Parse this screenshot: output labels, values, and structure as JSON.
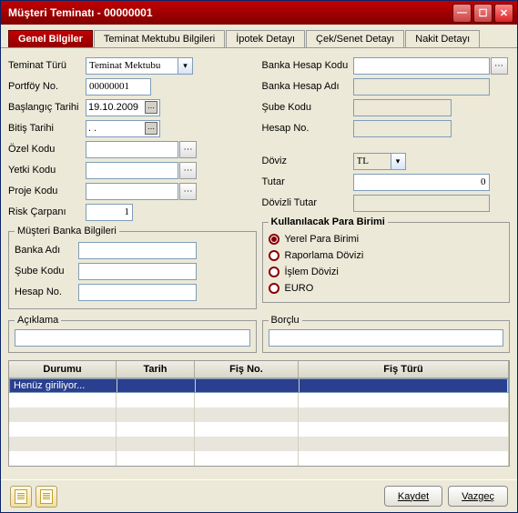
{
  "window": {
    "title": "Müşteri Teminatı - 00000001"
  },
  "tabs": {
    "t1": "Genel Bilgiler",
    "t2": "Teminat Mektubu Bilgileri",
    "t3": "İpotek Detayı",
    "t4": "Çek/Senet Detayı",
    "t5": "Nakit Detayı"
  },
  "labels": {
    "teminat_turu": "Teminat Türü",
    "portfoy_no": "Portföy No.",
    "baslangic": "Başlangıç Tarihi",
    "bitis": "Bitiş Tarihi",
    "ozel_kodu": "Özel Kodu",
    "yetki_kodu": "Yetki Kodu",
    "proje_kodu": "Proje Kodu",
    "risk_carpani": "Risk Çarpanı",
    "banka_hesap_kodu": "Banka Hesap Kodu",
    "banka_hesap_adi": "Banka Hesap Adı",
    "sube_kodu": "Şube Kodu",
    "hesap_no": "Hesap No.",
    "doviz": "Döviz",
    "tutar": "Tutar",
    "dovizli_tutar": "Dövizli Tutar",
    "banka_adi": "Banka Adı"
  },
  "values": {
    "teminat_turu": "Teminat Mektubu",
    "portfoy_no": "00000001",
    "baslangic": "19.10.2009",
    "bitis": ". .",
    "risk_carpani": "1",
    "doviz": "TL",
    "tutar": "0",
    "dovizli_tutar": ""
  },
  "groups": {
    "musteri_banka": "Müşteri Banka Bilgileri",
    "para_birimi": "Kullanılacak Para Birimi",
    "aciklama": "Açıklama",
    "borclu": "Borçlu"
  },
  "radios": {
    "r1": "Yerel Para Birimi",
    "r2": "Raporlama Dövizi",
    "r3": "İşlem Dövizi",
    "r4": "EURO"
  },
  "grid": {
    "h1": "Durumu",
    "h2": "Tarih",
    "h3": "Fiş No.",
    "h4": "Fiş Türü",
    "r1c1": "Henüz giriliyor..."
  },
  "buttons": {
    "kaydet": "Kaydet",
    "vazgec": "Vazgeç"
  }
}
